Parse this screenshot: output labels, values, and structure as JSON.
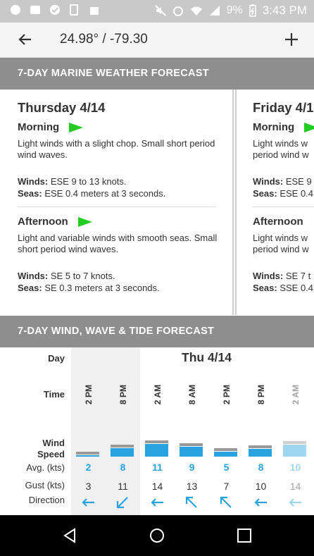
{
  "status_bar": {
    "battery": "9%",
    "time": "3:43 PM"
  },
  "app_bar": {
    "title": "24.98° / -79.30",
    "back_icon": "arrow-left-icon",
    "add_icon": "plus-icon"
  },
  "marine": {
    "header": "7-DAY MARINE WEATHER FORECAST",
    "cards": [
      {
        "day": "Thursday 4/14",
        "periods": [
          {
            "name": "Morning",
            "desc": "Light winds with a slight chop. Small short period wind waves.",
            "winds_label": "Winds:",
            "winds": "ESE 9 to 13 knots.",
            "seas_label": "Seas:",
            "seas": "ESE 0.4 meters at 3 seconds."
          },
          {
            "name": "Afternoon",
            "desc": "Light and variable winds with smooth seas. Small short period wind waves.",
            "winds_label": "Winds:",
            "winds": "SE 5 to 7 knots.",
            "seas_label": "Seas:",
            "seas": "SE 0.3 meters at 3 seconds."
          }
        ]
      },
      {
        "day": "Friday 4/1",
        "periods": [
          {
            "name": "Morning",
            "desc": "Light winds w period wind w",
            "winds_label": "Winds:",
            "winds": "ESE 9",
            "seas_label": "Seas:",
            "seas": "ESE 0.4"
          },
          {
            "name": "Afternoon",
            "desc": "Light winds w period wind w",
            "winds_label": "Winds:",
            "winds": "SE 7 t",
            "seas_label": "Seas:",
            "seas": "SSE 0.4"
          }
        ]
      }
    ]
  },
  "wind_table": {
    "header": "7-DAY WIND, WAVE & TIDE FORECAST",
    "labels": {
      "day": "Day",
      "time": "Time",
      "wind": "Wind",
      "speed": "Speed",
      "avg": "Avg. (kts)",
      "gust": "Gust (kts)",
      "direction": "Direction"
    },
    "day_label": "Thu 4/14",
    "columns": [
      {
        "time": "2 PM",
        "avg": "2",
        "gust": "3",
        "direction": "arrow-left-icon",
        "bar_fraction": 0.1,
        "shade": true
      },
      {
        "time": "8 PM",
        "avg": "8",
        "gust": "11",
        "direction": "arrow-down-left-icon",
        "bar_fraction": 0.5,
        "shade": true
      },
      {
        "time": "2 AM",
        "avg": "11",
        "gust": "14",
        "direction": "arrow-left-icon",
        "bar_fraction": 0.75,
        "shade": false
      },
      {
        "time": "8 AM",
        "avg": "9",
        "gust": "13",
        "direction": "arrow-up-left-icon",
        "bar_fraction": 0.6,
        "shade": false
      },
      {
        "time": "2 PM",
        "avg": "5",
        "gust": "7",
        "direction": "arrow-up-left-icon",
        "bar_fraction": 0.3,
        "shade": false
      },
      {
        "time": "8 PM",
        "avg": "8",
        "gust": "10",
        "direction": "arrow-left-icon",
        "bar_fraction": 0.45,
        "shade": false
      },
      {
        "time": "2 AM",
        "avg": "10",
        "gust": "14",
        "direction": "arrow-left-icon",
        "bar_fraction": 0.7,
        "shade": false,
        "faded": true
      }
    ]
  },
  "colors": {
    "accent": "#29a3e0",
    "flag": "#22cc22",
    "section": "#8e8e8e"
  }
}
